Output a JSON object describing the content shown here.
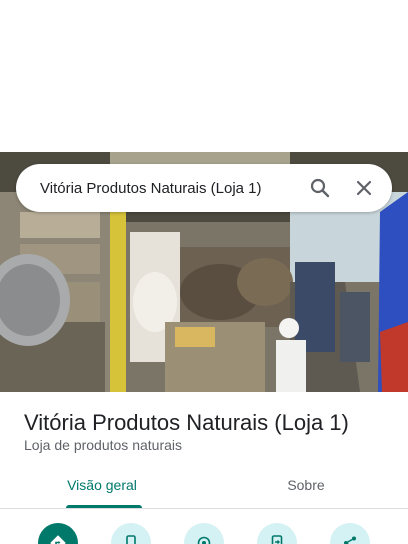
{
  "search": {
    "query": "Vitória Produtos Naturais (Loja 1)",
    "search_icon": "search-icon",
    "close_icon": "close-icon"
  },
  "place": {
    "title": "Vitória Produtos Naturais (Loja 1)",
    "category": "Loja de produtos naturais"
  },
  "tabs": [
    {
      "label": "Visão geral",
      "selected": true
    },
    {
      "label": "Sobre",
      "selected": false
    }
  ],
  "actions": [
    {
      "icon": "directions-icon",
      "primary": true
    },
    {
      "icon": "phone-icon",
      "primary": false
    },
    {
      "icon": "nearby-icon",
      "primary": false
    },
    {
      "icon": "send-to-phone-icon",
      "primary": false
    },
    {
      "icon": "share-icon",
      "primary": false
    }
  ],
  "colors": {
    "accent": "#00796b",
    "action_secondary_bg": "#d4f1f4",
    "text_primary": "#202124",
    "text_secondary": "#5f6368"
  }
}
